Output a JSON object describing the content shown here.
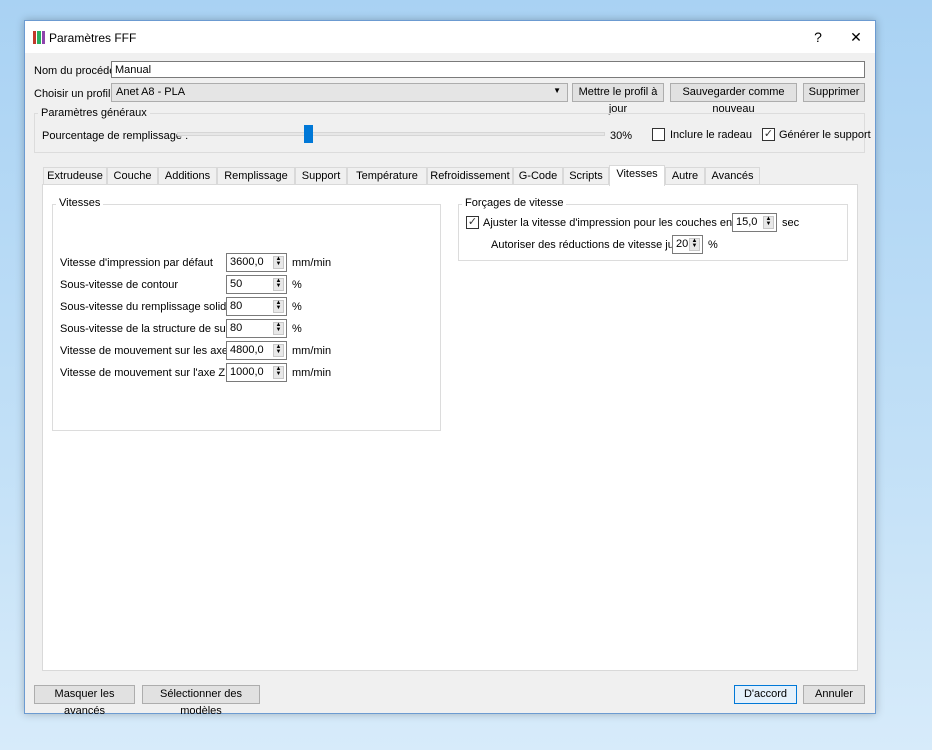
{
  "window": {
    "title": "Paramètres FFF",
    "help": "?",
    "close": "✕"
  },
  "process": {
    "label": "Nom du procédé :",
    "value": "Manual"
  },
  "profile": {
    "label": "Choisir un profil :",
    "value": "Anet A8 - PLA",
    "update": "Mettre le profil à jour",
    "save_new": "Sauvegarder comme nouveau",
    "delete": "Supprimer"
  },
  "general": {
    "title": "Paramètres généraux",
    "infill_label": "Pourcentage de remplissage :",
    "infill_value": "30%",
    "infill_percent": 30,
    "raft_label": "Inclure le radeau",
    "raft_checked": false,
    "support_label": "Générer le support",
    "support_checked": true
  },
  "tabs": [
    "Extrudeuse",
    "Couche",
    "Additions",
    "Remplissage",
    "Support",
    "Température",
    "Refroidissement",
    "G-Code",
    "Scripts",
    "Vitesses",
    "Autre",
    "Avancés"
  ],
  "selected_tab": "Vitesses",
  "speeds": {
    "title": "Vitesses",
    "rows": [
      {
        "label": "Vitesse d'impression par défaut",
        "value": "3600,0",
        "unit": "mm/min"
      },
      {
        "label": "Sous-vitesse de contour",
        "value": "50",
        "unit": "%"
      },
      {
        "label": "Sous-vitesse du remplissage solide",
        "value": "80",
        "unit": "%"
      },
      {
        "label": "Sous-vitesse de la structure de support",
        "value": "80",
        "unit": "%"
      },
      {
        "label": "Vitesse de mouvement sur les axes X/Y",
        "value": "4800,0",
        "unit": "mm/min"
      },
      {
        "label": "Vitesse de mouvement sur l'axe Z",
        "value": "1000,0",
        "unit": "mm/min"
      }
    ]
  },
  "overrides": {
    "title": "Forçages de vitesse",
    "adjust_label": "Ajuster la vitesse d'impression pour les couches en dessous",
    "adjust_checked": true,
    "adjust_value": "15,0",
    "adjust_unit": "sec",
    "allow_label": "Autoriser des réductions de vitesse jusqu'à",
    "allow_value": "20",
    "allow_unit": "%"
  },
  "footer": {
    "hide_advanced": "Masquer les avancés",
    "select_models": "Sélectionner des modèles",
    "ok": "D'accord",
    "cancel": "Annuler"
  }
}
